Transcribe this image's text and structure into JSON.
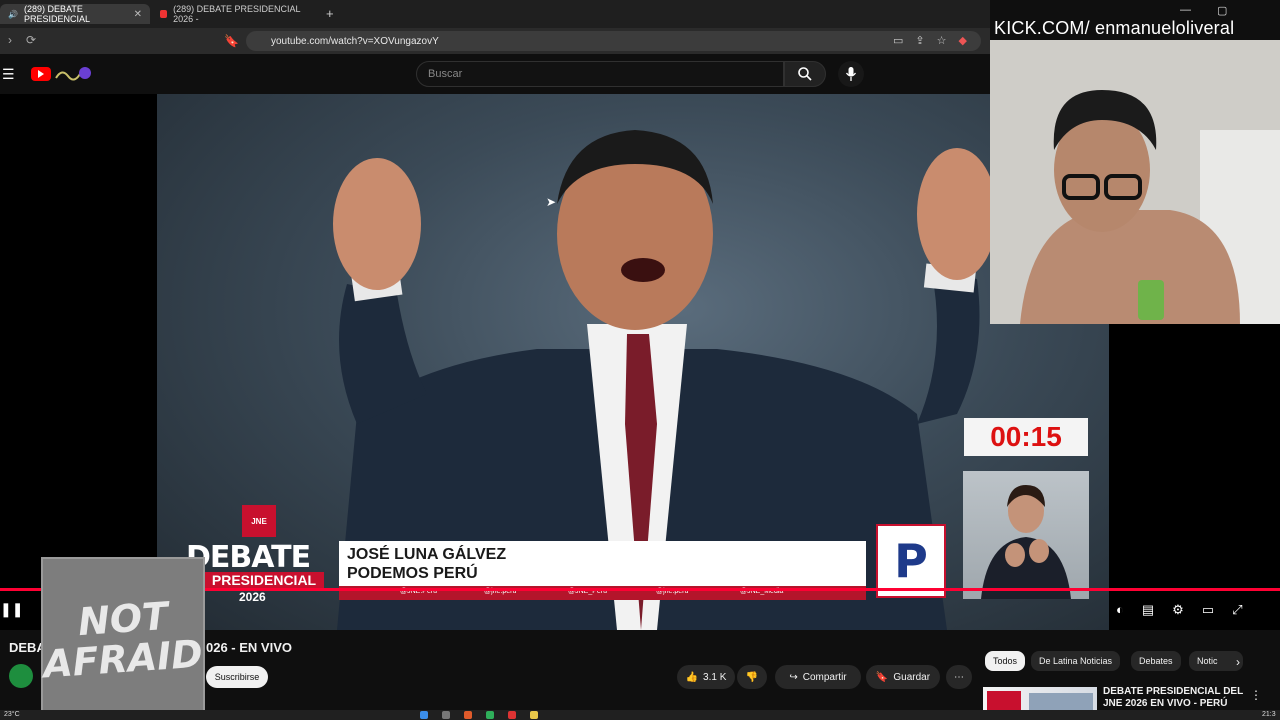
{
  "browser": {
    "tabs": [
      {
        "label": "(289) DEBATE PRESIDENCIAL",
        "active": true
      },
      {
        "label": "(289) DEBATE PRESIDENCIAL 2026 - ",
        "active": false
      }
    ],
    "url": "youtube.com/watch?v=XOVungazovY"
  },
  "youtube": {
    "search_placeholder": "Buscar"
  },
  "stream_overlay": {
    "kick_label": "KICK.COM/ enmanueloliveral"
  },
  "video": {
    "timer": "00:15",
    "program_logo": {
      "line1": "DEBATE",
      "line2": "PRESIDENCIAL",
      "line3": "2026"
    },
    "candidate_name": "JOSÉ LUNA GÁLVEZ",
    "candidate_party": "PODEMOS PERÚ",
    "party_logo_letter": "P",
    "socials": [
      "@JNE.Peru",
      "@jne.peru",
      "@JNE_Peru",
      "@jne.peru",
      "@JNE_Media"
    ],
    "progress_fraction": 1.0
  },
  "sticker": {
    "line1": "NOT",
    "line2": "AFRAID"
  },
  "below": {
    "title_left": "DEBA",
    "title_right": "026 - EN VIVO",
    "subscribe_label": "Suscribirse",
    "likes": "3.1 K",
    "share_label": "Compartir",
    "save_label": "Guardar",
    "chips": [
      "Todos",
      "De Latina Noticias",
      "Debates",
      "Notic"
    ],
    "suggested_title": "DEBATE PRESIDENCIAL DEL JNE 2026 EN VIVO - PERÚ"
  },
  "taskbar": {
    "weather": "23°C",
    "clock": "21:3"
  }
}
